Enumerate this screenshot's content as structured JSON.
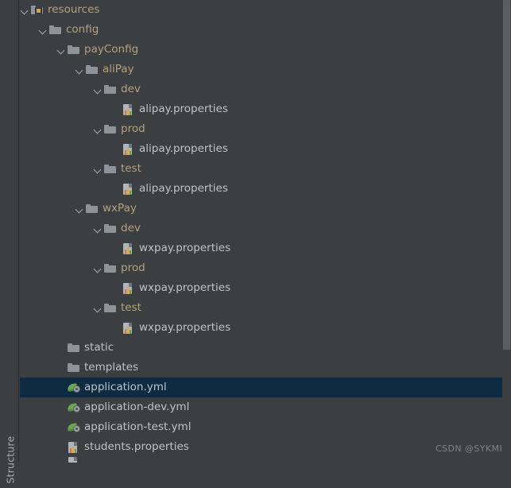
{
  "window": {
    "background_color": "#3c3f41",
    "selection_color": "#0d2c41"
  },
  "tool_window_strip": {
    "label": "Structure"
  },
  "watermark": {
    "text": "CSDN @SYKMI"
  },
  "scrollbar": {
    "thumb_color": "#5b5f61"
  },
  "tree": {
    "rows": [
      {
        "label": "resources",
        "depth": 3,
        "kind": "folder",
        "icon": "resources-folder-icon",
        "expanded": true,
        "selected": false
      },
      {
        "label": "config",
        "depth": 4,
        "kind": "folder",
        "icon": "folder-icon",
        "expanded": true,
        "selected": false
      },
      {
        "label": "payConfig",
        "depth": 5,
        "kind": "folder",
        "icon": "folder-icon",
        "expanded": true,
        "selected": false
      },
      {
        "label": "aliPay",
        "depth": 6,
        "kind": "folder",
        "icon": "folder-icon",
        "expanded": true,
        "selected": false
      },
      {
        "label": "dev",
        "depth": 7,
        "kind": "folder",
        "icon": "folder-icon",
        "expanded": true,
        "selected": false
      },
      {
        "label": "alipay.properties",
        "depth": 8,
        "kind": "file",
        "icon": "properties-file-icon",
        "expanded": false,
        "selected": false
      },
      {
        "label": "prod",
        "depth": 7,
        "kind": "folder",
        "icon": "folder-icon",
        "expanded": true,
        "selected": false
      },
      {
        "label": "alipay.properties",
        "depth": 8,
        "kind": "file",
        "icon": "properties-file-icon",
        "expanded": false,
        "selected": false
      },
      {
        "label": "test",
        "depth": 7,
        "kind": "folder",
        "icon": "folder-icon",
        "expanded": true,
        "selected": false
      },
      {
        "label": "alipay.properties",
        "depth": 8,
        "kind": "file",
        "icon": "properties-file-icon",
        "expanded": false,
        "selected": false
      },
      {
        "label": "wxPay",
        "depth": 6,
        "kind": "folder",
        "icon": "folder-icon",
        "expanded": true,
        "selected": false
      },
      {
        "label": "dev",
        "depth": 7,
        "kind": "folder",
        "icon": "folder-icon",
        "expanded": true,
        "selected": false
      },
      {
        "label": "wxpay.properties",
        "depth": 8,
        "kind": "file",
        "icon": "properties-file-icon",
        "expanded": false,
        "selected": false
      },
      {
        "label": "prod",
        "depth": 7,
        "kind": "folder",
        "icon": "folder-icon",
        "expanded": true,
        "selected": false
      },
      {
        "label": "wxpay.properties",
        "depth": 8,
        "kind": "file",
        "icon": "properties-file-icon",
        "expanded": false,
        "selected": false
      },
      {
        "label": "test",
        "depth": 7,
        "kind": "folder",
        "icon": "folder-icon",
        "expanded": true,
        "selected": false
      },
      {
        "label": "wxpay.properties",
        "depth": 8,
        "kind": "file",
        "icon": "properties-file-icon",
        "expanded": false,
        "selected": false
      },
      {
        "label": "static",
        "depth": 5,
        "kind": "plainfolder",
        "icon": "folder-icon",
        "expanded": false,
        "selected": false
      },
      {
        "label": "templates",
        "depth": 5,
        "kind": "plainfolder",
        "icon": "folder-icon",
        "expanded": false,
        "selected": false
      },
      {
        "label": "application.yml",
        "depth": 5,
        "kind": "file",
        "icon": "spring-yml-file-icon",
        "expanded": false,
        "selected": true
      },
      {
        "label": "application-dev.yml",
        "depth": 5,
        "kind": "file",
        "icon": "spring-yml-file-icon",
        "expanded": false,
        "selected": false
      },
      {
        "label": "application-test.yml",
        "depth": 5,
        "kind": "file",
        "icon": "spring-yml-file-icon",
        "expanded": false,
        "selected": false
      },
      {
        "label": "students.properties",
        "depth": 5,
        "kind": "file",
        "icon": "properties-file-icon",
        "expanded": false,
        "selected": false
      },
      {
        "label": "",
        "depth": 5,
        "kind": "file",
        "icon": "properties-file-icon",
        "expanded": false,
        "selected": false,
        "clipped": true
      }
    ]
  }
}
